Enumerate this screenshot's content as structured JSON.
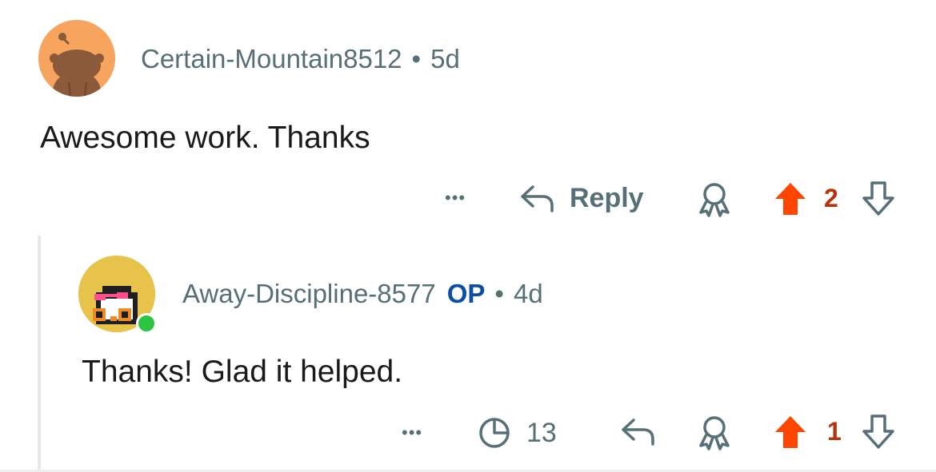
{
  "comments": [
    {
      "username": "Certain-Mountain8512",
      "separator": "•",
      "age": "5d",
      "text": "Awesome work. Thanks",
      "actions": {
        "more_label": "•••",
        "reply_label": "Reply",
        "vote_count": "2"
      }
    },
    {
      "username": "Away-Discipline-8577",
      "op_badge": "OP",
      "separator": "•",
      "age": "4d",
      "text": "Thanks! Glad it helped.",
      "actions": {
        "more_label": "•••",
        "views_count": "13",
        "vote_count": "1"
      }
    }
  ],
  "colors": {
    "upvote_active": "#ff4500",
    "meta_text": "#576f76",
    "op_badge": "#0b4fa5",
    "online": "#2bc541"
  },
  "icons": {
    "more": "ellipsis-icon",
    "reply": "reply-arrow-icon",
    "award": "award-icon",
    "upvote": "upvote-arrow-icon",
    "downvote": "downvote-arrow-icon",
    "views": "pie-clock-icon"
  }
}
